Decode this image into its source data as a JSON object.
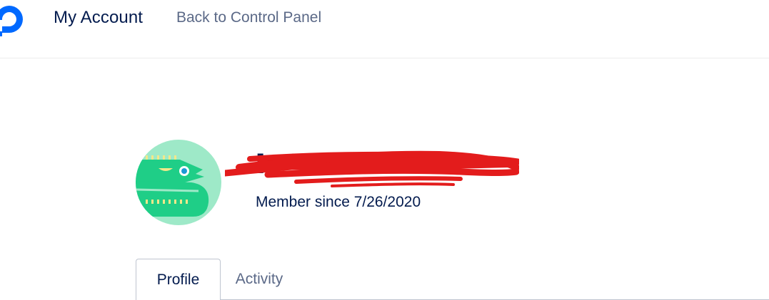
{
  "header": {
    "logo_icon": "digitalocean-logo-icon",
    "title": "My Account",
    "back_link": "Back to Control Panel"
  },
  "profile": {
    "avatar_icon": "dragon-avatar-icon",
    "username": "[redacted]",
    "member_since": "Member since 7/26/2020"
  },
  "tabs": [
    {
      "label": "Profile",
      "active": true
    },
    {
      "label": "Activity",
      "active": false
    }
  ],
  "colors": {
    "brand_blue": "#0069ff",
    "text_dark": "#031b4e",
    "text_muted": "#5b6987",
    "avatar_bg": "#9ee9c8",
    "avatar_green": "#1fce87",
    "avatar_yellow": "#f2e88a",
    "redaction_red": "#e31c1c"
  }
}
